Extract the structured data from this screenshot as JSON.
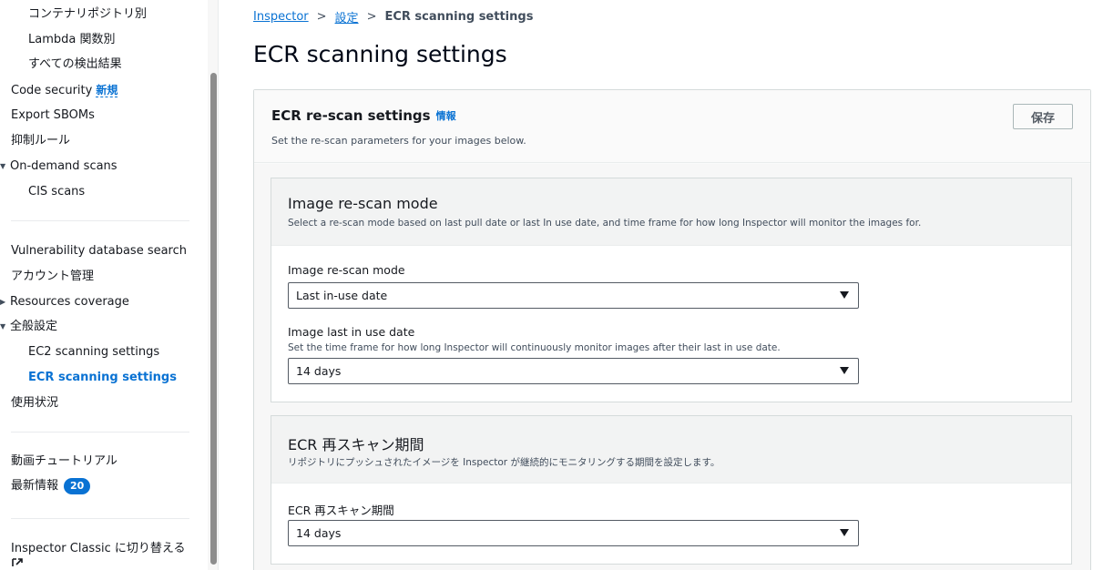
{
  "sidebar": {
    "sub_items_top": [
      {
        "label": "コンテナリポジトリ別"
      },
      {
        "label": "Lambda 関数別"
      },
      {
        "label": "すべての検出結果"
      }
    ],
    "code_security": {
      "label": "Code security",
      "badge": "新規"
    },
    "export_sboms": "Export SBOMs",
    "suppression_rules": "抑制ルール",
    "on_demand_scans": {
      "label": "On-demand scans",
      "caret": "▼"
    },
    "cis_scans": "CIS scans",
    "vuln_db_search": "Vulnerability database search",
    "account_mgmt": "アカウント管理",
    "resources_coverage": {
      "label": "Resources coverage",
      "caret": "▶"
    },
    "general_settings": {
      "label": "全般設定",
      "caret": "▼"
    },
    "ec2_scanning": "EC2 scanning settings",
    "ecr_scanning": "ECR scanning settings",
    "usage": "使用状況",
    "video_tutorials": "動画チュートリアル",
    "whats_new": {
      "label": "最新情報",
      "count": "20"
    },
    "switch_classic": "Inspector Classic に切り替える"
  },
  "breadcrumb": {
    "items": [
      "Inspector",
      "設定"
    ],
    "current": "ECR scanning settings",
    "separator": ">"
  },
  "page": {
    "title": "ECR scanning settings"
  },
  "rescan_settings": {
    "title": "ECR re-scan settings",
    "info": "情報",
    "description": "Set the re-scan parameters for your images below.",
    "save_label": "保存"
  },
  "image_rescan_panel": {
    "title": "Image re-scan mode",
    "description": "Select a re-scan mode based on last pull date or last In use date, and time frame for how long Inspector will monitor the images for.",
    "mode_label": "Image re-scan mode",
    "mode_value": "Last in-use date",
    "duration_label": "Image last in use date",
    "duration_description": "Set the time frame for how long Inspector will continuously monitor images after their last in use date.",
    "duration_value": "14 days"
  },
  "ecr_rescan_panel": {
    "title": "ECR 再スキャン期間",
    "description": "リポジトリにプッシュされたイメージを Inspector が継続的にモニタリングする期間を設定します。",
    "duration_label": "ECR 再スキャン期間",
    "duration_value": "14 days"
  },
  "colors": {
    "accent": "#0972d3",
    "text": "#16191f",
    "border": "#d5dbdb"
  }
}
